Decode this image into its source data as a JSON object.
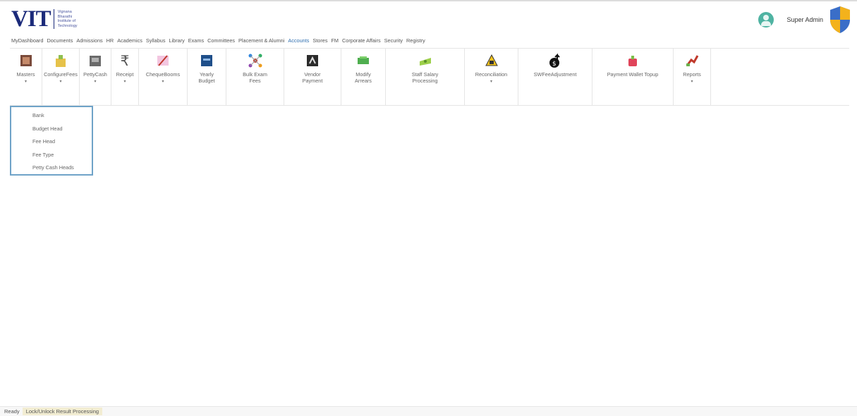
{
  "app": {
    "logo_mark": "VIT",
    "logo_lines": [
      "Vignana Bharathi",
      "Institute of",
      "Technology"
    ]
  },
  "user": {
    "name": "Super Admin"
  },
  "menu": {
    "items": [
      "MyDashboard",
      "Documents",
      "Admissions",
      "HR",
      "Academics",
      "Syllabus",
      "Library",
      "Exams",
      "Committees",
      "Placement & Alumni",
      "Accounts",
      "Stores",
      "FM",
      "Corporate Affairs",
      "Security",
      "Registry"
    ],
    "active": "Accounts"
  },
  "toolbar": {
    "items": [
      {
        "label": "Masters",
        "caret": "▾",
        "icon": "masters-icon"
      },
      {
        "label": "ConfigureFees",
        "caret": "▾",
        "icon": "building-icon"
      },
      {
        "label": "PettyCash",
        "caret": "▾",
        "icon": "cash-icon"
      },
      {
        "label": "Receipt",
        "caret": "▾",
        "icon": "rupee-icon"
      },
      {
        "label": "ChequeBooms",
        "caret": "▾",
        "icon": "cheque-icon"
      },
      {
        "label": "Yearly\nBudget",
        "caret": "",
        "icon": "budget-icon"
      },
      {
        "label": "Bulk Exam\nFees",
        "caret": "",
        "icon": "network-icon"
      },
      {
        "label": "Vendor\nPayment",
        "caret": "",
        "icon": "vendor-icon"
      },
      {
        "label": "Modify\nArrears",
        "caret": "",
        "icon": "money-icon"
      },
      {
        "label": "Staff Salary\nProcessing",
        "caret": "",
        "icon": "salary-icon"
      },
      {
        "label": "Reconciliation",
        "caret": "▾",
        "icon": "reconcile-icon"
      },
      {
        "label": "SWFeeAdjustment",
        "caret": "",
        "icon": "moneybag-icon"
      },
      {
        "label": "Payment Wallet Topup",
        "caret": "",
        "icon": "wallet-icon"
      },
      {
        "label": "Reports",
        "caret": "▾",
        "icon": "reports-icon"
      }
    ]
  },
  "dropdown": {
    "items": [
      "Bank",
      "Budget Head",
      "Fee Head",
      "Fee Type",
      "Petty Cash Heads"
    ]
  },
  "status": {
    "ready": "Ready",
    "lock": "Lock/Unlock Result Processing"
  },
  "colors": {
    "logo": "#1b2a7a",
    "active_menu": "#2f6fb0",
    "dropdown_border": "#6fa3c8",
    "status_highlight": "#f2edd2"
  }
}
